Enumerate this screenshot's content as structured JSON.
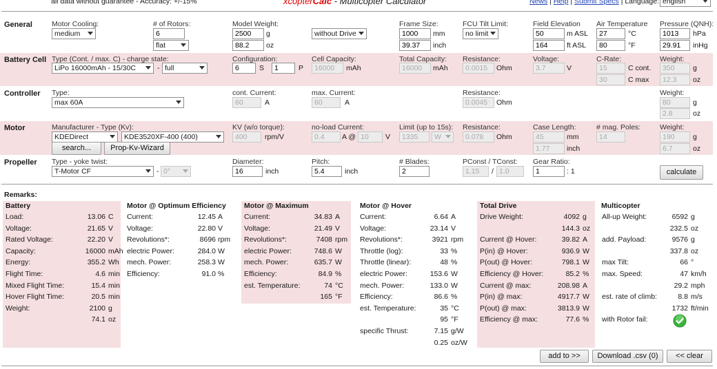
{
  "header": {
    "disclaimer": "all data without guarantee - Accuracy: +/-15%",
    "title_prefix": "xcopter",
    "title_bold": "Calc",
    "title_suffix": " - Multicopter Calculator",
    "links": [
      "News",
      "Help",
      "Submit Specs"
    ],
    "language_label": "Language:",
    "language_value": "english"
  },
  "sections": {
    "general": "General",
    "battery": "Battery Cell",
    "controller": "Controller",
    "motor": "Motor",
    "propeller": "Propeller"
  },
  "general": {
    "cooling_label": "Motor Cooling:",
    "cooling_value": "medium",
    "rotors_label": "# of Rotors:",
    "rotors_value": "6",
    "frame_type": "flat",
    "weight_label": "Model Weight:",
    "weight_g": "2500",
    "weight_oz": "88.2",
    "drive_mode": "without Drive",
    "frame_label": "Frame Size:",
    "frame_mm": "1000",
    "frame_inch": "39.37",
    "tilt_label": "FCU Tilt Limit:",
    "tilt_value": "no limit",
    "elev_label": "Field Elevation",
    "elev_m": "50",
    "elev_ft": "164",
    "temp_label": "Air Temperature",
    "temp_c": "27",
    "temp_f": "80",
    "press_label": "Pressure (QNH):",
    "press_hpa": "1013",
    "press_inhg": "29.91",
    "u_g": "g",
    "u_oz": "oz",
    "u_mm": "mm",
    "u_inch": "inch",
    "u_masl": "m ASL",
    "u_ftasl": "ft ASL",
    "u_c": "°C",
    "u_f": "°F",
    "u_hpa": "hPa",
    "u_inhg": "inHg"
  },
  "battery": {
    "type_label": "Type (Cont. / max. C) - charge state:",
    "type_value": "LiPo 16000mAh - 15/30C",
    "dash": "-",
    "charge_value": "full",
    "config_label": "Configuration:",
    "config_s": "6",
    "config_p": "1",
    "u_s": "S",
    "u_p": "P",
    "cell_cap_label": "Cell Capacity:",
    "cell_cap": "16000",
    "u_mah": "mAh",
    "total_cap_label": "Total Capacity:",
    "total_cap": "16000",
    "res_label": "Resistance:",
    "res": "0.0015",
    "u_ohm": "Ohm",
    "volt_label": "Voltage:",
    "volt": "3.7",
    "u_v": "V",
    "crate_label": "C-Rate:",
    "c_cont": "15",
    "u_ccont": "C cont.",
    "c_max": "30",
    "u_cmax": "C max",
    "weight_label": "Weight:",
    "weight_g": "350",
    "weight_oz": "12.3"
  },
  "controller": {
    "type_label": "Type:",
    "type_value": "max 60A",
    "cont_label": "cont. Current:",
    "cont": "60",
    "u_a": "A",
    "max_label": "max. Current:",
    "max": "60",
    "res_label": "Resistance:",
    "res": "0.0045",
    "weight_label": "Weight:",
    "weight_g": "80",
    "weight_oz": "2.8"
  },
  "motor": {
    "mfr_label": "Manufacturer - Type (Kv):",
    "mfr_value": "KDEDirect",
    "type_value": "KDE3520XF-400 (400)",
    "search_btn": "search...",
    "wizard_btn": "Prop-Kv-Wizard",
    "kv_label": "KV (w/o torque):",
    "kv": "400",
    "u_rpmv": "rpm/V",
    "noload_label": "no-load Current:",
    "noload_a": "0.4",
    "u_a_at": "A @",
    "noload_v": "10",
    "u_v": "V",
    "limit_label": "Limit (up to 15s):",
    "limit": "1335",
    "limit_unit": "W",
    "res_label": "Resistance:",
    "res": "0.078",
    "case_label": "Case Length:",
    "case_mm": "45",
    "case_inch": "1.77",
    "poles_label": "# mag. Poles:",
    "poles": "14",
    "weight_label": "Weight:",
    "weight_g": "190",
    "weight_oz": "6.7"
  },
  "propeller": {
    "type_label": "Type - yoke twist:",
    "type_value": "T-Motor CF",
    "twist": "0°",
    "diam_label": "Diameter:",
    "diam": "16",
    "pitch_label": "Pitch:",
    "pitch": "5.4",
    "blades_label": "# Blades:",
    "blades": "2",
    "pconst_label": "PConst / TConst:",
    "pconst": "1.15",
    "slash": "/",
    "tconst": "1.0",
    "gear_label": "Gear Ratio:",
    "gear": "1",
    "gear_suffix": ": 1",
    "calc_btn": "calculate"
  },
  "remarks": {
    "label": "Remarks:",
    "battery": {
      "title": "Battery",
      "rows": [
        {
          "l": "Load:",
          "v": "13.06",
          "u": "C"
        },
        {
          "l": "Voltage:",
          "v": "21.65",
          "u": "V"
        },
        {
          "l": "Rated Voltage:",
          "v": "22.20",
          "u": "V"
        },
        {
          "l": "Capacity:",
          "v": "16000",
          "u": "mAh"
        },
        {
          "l": "Energy:",
          "v": "355.2",
          "u": "Wh"
        },
        {
          "l": "Flight Time:",
          "v": "4.6",
          "u": "min"
        },
        {
          "l": "Mixed Flight Time:",
          "v": "15.4",
          "u": "min"
        },
        {
          "l": "Hover Flight Time:",
          "v": "20.5",
          "u": "min"
        },
        {
          "l": "Weight:",
          "v": "2100",
          "u": "g"
        },
        {
          "l": "",
          "v": "74.1",
          "u": "oz"
        }
      ]
    },
    "motor_opt": {
      "title": "Motor @ Optimum Efficiency",
      "rows": [
        {
          "l": "Current:",
          "v": "12.45",
          "u": "A"
        },
        {
          "l": "Voltage:",
          "v": "22.80",
          "u": "V"
        },
        {
          "l": "Revolutions*:",
          "v": "8696",
          "u": "rpm"
        },
        {
          "l": "electric Power:",
          "v": "284.0",
          "u": "W"
        },
        {
          "l": "mech. Power:",
          "v": "258.3",
          "u": "W"
        },
        {
          "l": "Efficiency:",
          "v": "91.0",
          "u": "%"
        }
      ]
    },
    "motor_max": {
      "title": "Motor @ Maximum",
      "rows": [
        {
          "l": "Current:",
          "v": "34.83",
          "u": "A"
        },
        {
          "l": "Voltage:",
          "v": "21.49",
          "u": "V"
        },
        {
          "l": "Revolutions*:",
          "v": "7408",
          "u": "rpm"
        },
        {
          "l": "electric Power:",
          "v": "748.6",
          "u": "W"
        },
        {
          "l": "mech. Power:",
          "v": "635.7",
          "u": "W"
        },
        {
          "l": "Efficiency:",
          "v": "84.9",
          "u": "%"
        },
        {
          "l": "est. Temperature:",
          "v": "74",
          "u": "°C"
        },
        {
          "l": "",
          "v": "165",
          "u": "°F"
        }
      ]
    },
    "motor_hover": {
      "title": "Motor @ Hover",
      "rows": [
        {
          "l": "Current:",
          "v": "6.64",
          "u": "A"
        },
        {
          "l": "Voltage:",
          "v": "23.14",
          "u": "V"
        },
        {
          "l": "Revolutions*:",
          "v": "3921",
          "u": "rpm"
        },
        {
          "l": "Throttle (log):",
          "v": "33",
          "u": "%"
        },
        {
          "l": "Throttle (linear):",
          "v": "48",
          "u": "%"
        },
        {
          "l": "electric Power:",
          "v": "153.6",
          "u": "W"
        },
        {
          "l": "mech. Power:",
          "v": "133.0",
          "u": "W"
        },
        {
          "l": "Efficiency:",
          "v": "86.6",
          "u": "%"
        },
        {
          "l": "est. Temperature:",
          "v": "35",
          "u": "°C"
        },
        {
          "l": "",
          "v": "95",
          "u": "°F"
        },
        {
          "l": "specific Thrust:",
          "v": "7.15",
          "u": "g/W"
        },
        {
          "l": "",
          "v": "0.25",
          "u": "oz/W"
        }
      ]
    },
    "total": {
      "title": "Total Drive",
      "rows": [
        {
          "l": "Drive Weight:",
          "v": "4092",
          "u": "g"
        },
        {
          "l": "",
          "v": "144.3",
          "u": "oz"
        },
        {
          "l": "Current @ Hover:",
          "v": "39.82",
          "u": "A"
        },
        {
          "l": "P(in) @ Hover:",
          "v": "936.9",
          "u": "W"
        },
        {
          "l": "P(out) @ Hover:",
          "v": "798.1",
          "u": "W"
        },
        {
          "l": "Efficiency @ Hover:",
          "v": "85.2",
          "u": "%"
        },
        {
          "l": "Current @ max:",
          "v": "208.98",
          "u": "A"
        },
        {
          "l": "P(in) @ max:",
          "v": "4917.7",
          "u": "W"
        },
        {
          "l": "P(out) @ max:",
          "v": "3813.9",
          "u": "W"
        },
        {
          "l": "Efficiency @ max:",
          "v": "77.6",
          "u": "%"
        }
      ]
    },
    "multi": {
      "title": "Multicopter",
      "rows": [
        {
          "l": "All-up Weight:",
          "v": "6592",
          "u": "g"
        },
        {
          "l": "",
          "v": "232.5",
          "u": "oz"
        },
        {
          "l": "add. Payload:",
          "v": "9576",
          "u": "g"
        },
        {
          "l": "",
          "v": "337.8",
          "u": "oz"
        },
        {
          "l": "max Tilt:",
          "v": "66",
          "u": "°"
        },
        {
          "l": "max. Speed:",
          "v": "47",
          "u": "km/h"
        },
        {
          "l": "",
          "v": "29.2",
          "u": "mph"
        },
        {
          "l": "est. rate of climb:",
          "v": "8.8",
          "u": "m/s"
        },
        {
          "l": "",
          "v": "1732",
          "u": "ft/min"
        },
        {
          "l": "with Rotor fail:",
          "v": "",
          "u": ""
        }
      ]
    }
  },
  "footer": {
    "add_btn": "add to >>",
    "download_btn": "Download .csv (0)",
    "clear_btn": "<< clear"
  },
  "colors": {
    "pink": "#f5dfe1",
    "title_red": "#e00000",
    "link": "#1f43b5",
    "ok_green": "#3ab53a"
  }
}
